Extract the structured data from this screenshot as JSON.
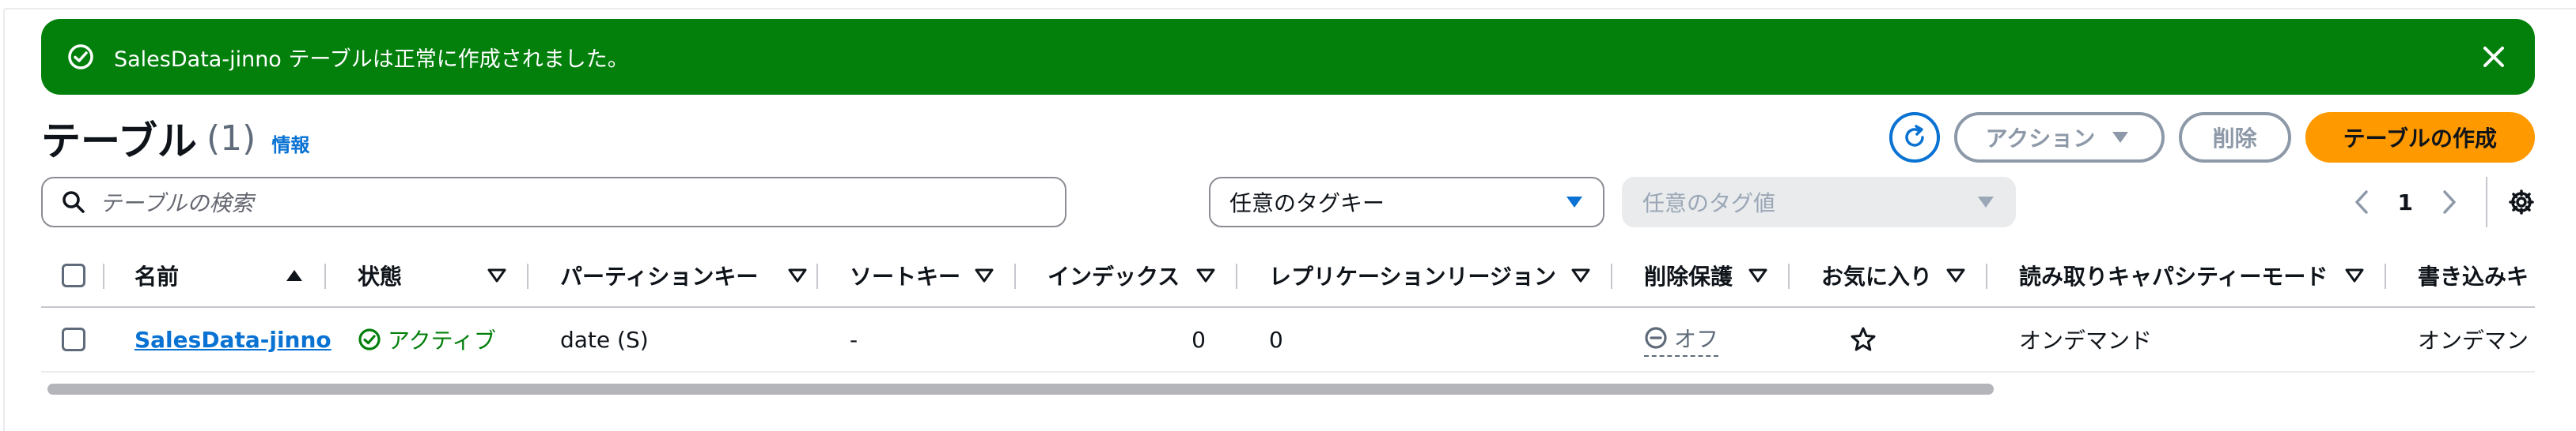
{
  "flash": {
    "message": "SalesData-jinno テーブルは正常に作成されました。",
    "color": "#037f0c"
  },
  "header": {
    "title": "テーブル",
    "count": "(1)",
    "info": "情報"
  },
  "actions": {
    "action_label": "アクション",
    "delete_label": "削除",
    "create_label": "テーブルの作成"
  },
  "filters": {
    "search_placeholder": "テーブルの検索",
    "tag_key": "任意のタグキー",
    "tag_value_placeholder": "任意のタグ値"
  },
  "pagination": {
    "page": "1"
  },
  "table": {
    "columns": [
      {
        "label": "名前"
      },
      {
        "label": "状態"
      },
      {
        "label": "パーティションキー"
      },
      {
        "label": "ソートキー"
      },
      {
        "label": "インデックス"
      },
      {
        "label": "レプリケーションリージョン"
      },
      {
        "label": "削除保護"
      },
      {
        "label": "お気に入り"
      },
      {
        "label": "読み取りキャパシティーモード"
      },
      {
        "label": "書き込みキ"
      }
    ],
    "rows": [
      {
        "name": "SalesData-jinno",
        "status": "アクティブ",
        "partition_key": "date (S)",
        "sort_key": "-",
        "indexes": "0",
        "replication_regions": "0",
        "deletion_protection": "オフ",
        "read_capacity_mode": "オンデマンド",
        "write_capacity_mode": "オンデマン"
      }
    ]
  },
  "colors": {
    "primary": "#ff9900",
    "link": "#0972d3",
    "success": "#037f0c"
  }
}
